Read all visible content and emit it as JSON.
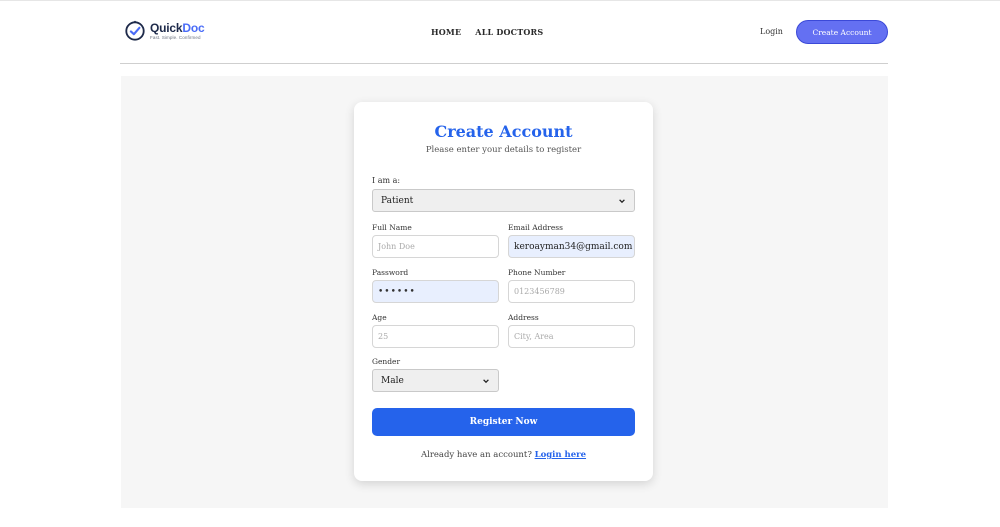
{
  "brand": {
    "name_part1": "Quick",
    "name_part2": "Doc",
    "tagline": "Fast. Simple. Confirmed"
  },
  "nav": {
    "home": "HOME",
    "all_doctors": "ALL DOCTORS",
    "login": "Login",
    "create_account": "Create Account"
  },
  "form": {
    "title": "Create Account",
    "subtitle": "Please enter your details to register",
    "role_label": "I am a:",
    "role_value": "Patient",
    "full_name_label": "Full Name",
    "full_name_placeholder": "John Doe",
    "email_label": "Email Address",
    "email_value": "keroayman34@gmail.com",
    "password_label": "Password",
    "password_value": "••••••",
    "phone_label": "Phone Number",
    "phone_placeholder": "0123456789",
    "age_label": "Age",
    "age_placeholder": "25",
    "address_label": "Address",
    "address_placeholder": "City, Area",
    "gender_label": "Gender",
    "gender_value": "Male",
    "register_label": "Register Now",
    "footer_prompt": "Already have an account?",
    "footer_link": "Login here"
  },
  "colors": {
    "primary": "#2563eb",
    "nav_button": "#6470f2",
    "autofill": "#e8effe"
  }
}
